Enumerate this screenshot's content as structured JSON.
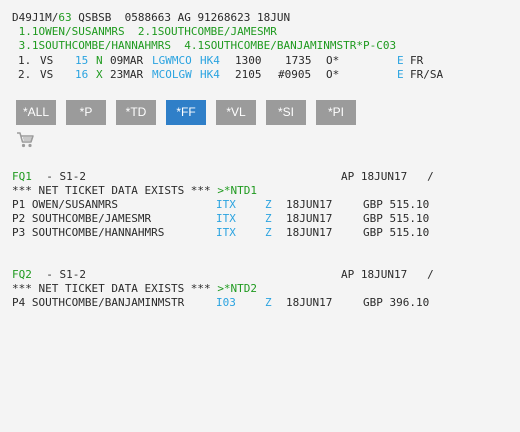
{
  "header": {
    "pnr_code": "D49J1M/",
    "pnr_agent": "63",
    "pnr_rest": " QSBSB  0588663 AG 91268623 18JUN"
  },
  "passengers": {
    "row1": {
      "p1": " 1.1OWEN/SUSANMRS",
      "p2": "  2.1SOUTHCOMBE/JAMESMR"
    },
    "row2": {
      "p1": " 3.1SOUTHCOMBE/HANNAHMRS",
      "p2": "  4.1SOUTHCOMBE/BANJAMINMSTR*P-C03"
    }
  },
  "segments": [
    {
      "num": "1.",
      "airline": "VS",
      "flight": "15",
      "cls": "N",
      "date": "09MAR",
      "route": "LGWMCO",
      "status": "HK4",
      "dep": "1300",
      "arr": "1735",
      "flag": "O*",
      "e": "E",
      "eq": "FR"
    },
    {
      "num": "2.",
      "airline": "VS",
      "flight": "16",
      "cls": "X",
      "date": "23MAR",
      "route": "MCOLGW",
      "status": "HK4",
      "dep": "2105",
      "arr": "#0905",
      "flag": "O*",
      "e": "E",
      "eq": "FR/SA"
    }
  ],
  "toolbar": {
    "buttons": [
      "*ALL",
      "*P",
      "*TD",
      "*FF",
      "*VL",
      "*SI",
      "*PI"
    ],
    "active": "*FF",
    "cart_icon": "shopping-cart-icon"
  },
  "fares": [
    {
      "fq": "FQ1",
      "segs": "  - S1-2",
      "ap": "AP 18JUN17   /",
      "net_text": "*** NET TICKET DATA EXISTS *** ",
      "net_cmd": ">*NTD1",
      "lines": [
        {
          "p": "P1 OWEN/SUSANMRS",
          "code": "ITX",
          "z": "Z",
          "date": "18JUN17",
          "amt": "GBP 515.10"
        },
        {
          "p": "P2 SOUTHCOMBE/JAMESMR",
          "code": "ITX",
          "z": "Z",
          "date": "18JUN17",
          "amt": "GBP 515.10"
        },
        {
          "p": "P3 SOUTHCOMBE/HANNAHMRS",
          "code": "ITX",
          "z": "Z",
          "date": "18JUN17",
          "amt": "GBP 515.10"
        }
      ]
    },
    {
      "fq": "FQ2",
      "segs": "  - S1-2",
      "ap": "AP 18JUN17   /",
      "net_text": "*** NET TICKET DATA EXISTS *** ",
      "net_cmd": ">*NTD2",
      "lines": [
        {
          "p": "P4 SOUTHCOMBE/BANJAMINMSTR",
          "code": "I03",
          "z": "Z",
          "date": "18JUN17",
          "amt": "GBP 396.10"
        }
      ]
    }
  ],
  "colors": {
    "green": "#1f9a1f",
    "blue": "#2aa3e0",
    "button": "#9b9b9b",
    "button_active": "#2f7fc8"
  }
}
